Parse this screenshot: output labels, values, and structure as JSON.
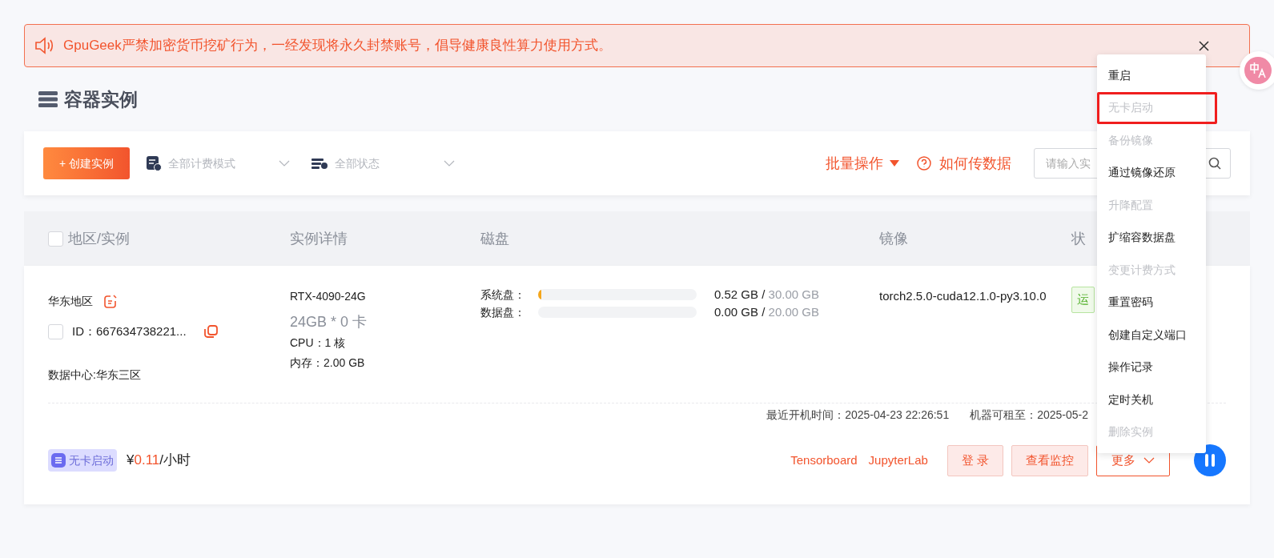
{
  "notice": {
    "text": "GpuGeek严禁加密货币挖矿行为，一经发现将永久封禁账号，倡导健康良性算力使用方式。",
    "closable": true
  },
  "page_title": "容器实例",
  "toolbar": {
    "create_button": "+ 创建实例",
    "filters": [
      {
        "kind": "billing",
        "label": "全部计费模式"
      },
      {
        "kind": "status",
        "label": "全部状态"
      }
    ],
    "batch_button": "批量操作",
    "help_link": "如何传数据",
    "search": {
      "placeholder": "请输入实"
    }
  },
  "table": {
    "columns": [
      "地区/实例",
      "实例详情",
      "磁盘",
      "镜像",
      "状"
    ],
    "select_all": false,
    "rows": [
      {
        "region": "华东地区",
        "selected": false,
        "id": "ID：667634738221...",
        "datacenter": "数据中心:华东三区",
        "gpu": "RTX-4090-24G",
        "gpu_spec": "24GB * 0 卡",
        "cpu": "CPU：1 核",
        "memory": "内存：2.00 GB",
        "disks": [
          {
            "label": "系统盘：",
            "level": 0.02,
            "used": "0.52 GB",
            "sep": " / ",
            "total": "30.00 GB"
          },
          {
            "label": "数据盘：",
            "level": 0,
            "used": "0.00 GB",
            "sep": " / ",
            "total": "20.00 GB"
          }
        ],
        "image": "torch2.5.0-cuda12.1.0-py3.10.0",
        "status": "运",
        "last_boot": "最近开机时间：2025-04-23 22:26:51",
        "rent_until": "机器可租至：2025-05-2",
        "mode_badge": "无卡启动",
        "price": {
          "currency": "¥",
          "amount": "0.11",
          "unit": "/小时"
        },
        "links": [
          "Tensorboard",
          "JupyterLab"
        ],
        "buttons": [
          "登 录",
          "查看监控"
        ],
        "more_button": "更多"
      }
    ]
  },
  "menu": [
    {
      "label": "重启",
      "disabled": false,
      "outlined": false
    },
    {
      "label": "无卡启动",
      "disabled": true,
      "outlined": true
    },
    {
      "label": "备份镜像",
      "disabled": true,
      "outlined": false
    },
    {
      "label": "通过镜像还原",
      "disabled": false,
      "outlined": false
    },
    {
      "label": "升降配置",
      "disabled": true,
      "outlined": false
    },
    {
      "label": "扩缩容数据盘",
      "disabled": false,
      "outlined": false
    },
    {
      "label": "变更计费方式",
      "disabled": true,
      "outlined": false
    },
    {
      "label": "重置密码",
      "disabled": false,
      "outlined": false
    },
    {
      "label": "创建自定义端口",
      "disabled": false,
      "outlined": false
    },
    {
      "label": "操作记录",
      "disabled": false,
      "outlined": false
    },
    {
      "label": "定时关机",
      "disabled": false,
      "outlined": false
    },
    {
      "label": "删除实例",
      "disabled": true,
      "outlined": false
    }
  ]
}
